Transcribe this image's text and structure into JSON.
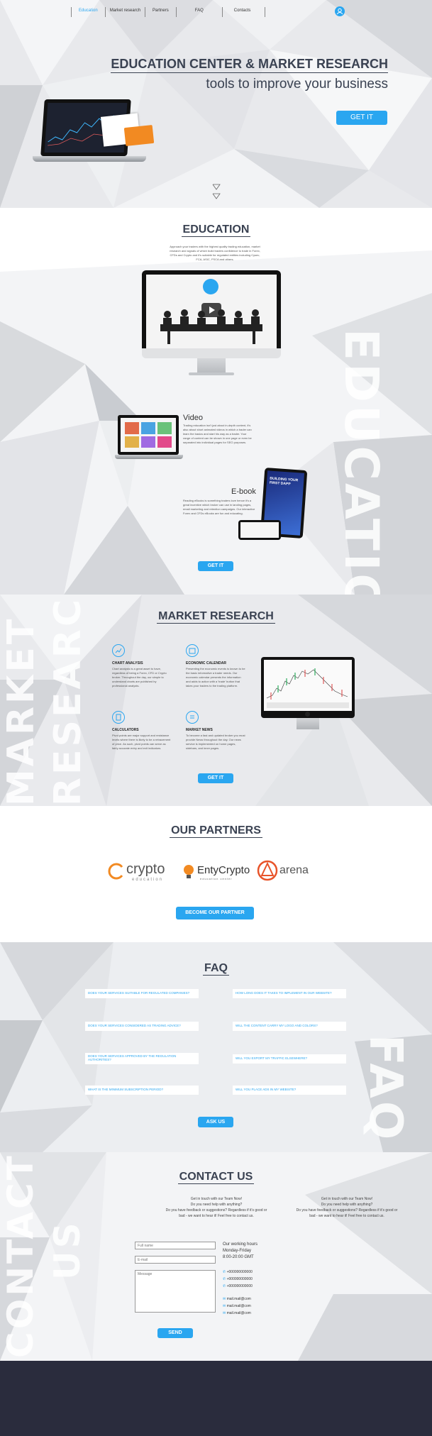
{
  "nav": {
    "items": [
      {
        "label": "Education",
        "active": true
      },
      {
        "label": "Market research",
        "active": false
      },
      {
        "label": "Partners",
        "active": false
      },
      {
        "label": "FAQ",
        "active": false
      },
      {
        "label": "Contacts",
        "active": false
      }
    ],
    "user_icon": "user-icon"
  },
  "hero": {
    "title": "EDUCATION CENTER & MARKET RESEARCH",
    "subtitle": "tools to improve your business",
    "cta": "GET IT",
    "scroll_icon": "chevron-down-icon"
  },
  "education": {
    "title": "EDUCATION",
    "intro": "Approach your traders with the highest quality trading education, market research and signals of which build traders confidence to trade in Forex, CFDs and Crypto and it's suitable for regulated entities including Cysec, FCA, ASIC, FSCA and others.",
    "screen_badge": "FORKHT",
    "video_title": "Video",
    "video_text": "Trading education isn't just about in-depth content, it's also about short animated videos in which a trader can learn the basics and start his way as a trader. Your range of content can be shown in one page or even be separated into individual pages for SEO purposes.",
    "ebook_title": "E-book",
    "ebook_text": "Reading eBooks is something traders love hence it's a great incentive which broker can use in landing pages, email marketing and retention campaigns. Our interactive Forex and CFDs eBooks are fun and educating.",
    "ebook_cover": "BUILDING YOUR FIRST DAPP",
    "cta": "GET IT",
    "bg_word": "EDUCATION"
  },
  "market": {
    "title": "MARKET RESEARCH",
    "bg_word_1": "MARKET",
    "bg_word_2": "RESEARCH",
    "items": [
      {
        "title": "CHART ANALYSIS",
        "text": "Chart analysis is a great asset to have, regardless of being a Forex, CFD or Crypto broker. Throughout the day, our simple to understand charts are published by professional analysts.",
        "icon": "chart-icon"
      },
      {
        "title": "ECONOMIC CALENDAR",
        "text": "Presenting the economic events is known to be the basic informative a trader needs. Our economic calendar presents the information and adds to action with a 'trade' button that takes your traders to the trading platform.",
        "icon": "calendar-icon"
      },
      {
        "title": "CALCULATORS",
        "text": "Pivot points are major support and resistance levels where there is likely to be a retracement of price. As such, pivot points can serve as fairly accurate entry and exit indicators.",
        "icon": "calculator-icon"
      },
      {
        "title": "MARKET NEWS",
        "text": "To become a fast and updated broker you must provide News throughout the day. Our news service is implemented on home pages, sidebars, and inner pages.",
        "icon": "news-icon"
      }
    ],
    "cta": "GET IT"
  },
  "partners": {
    "title": "OUR PARTNERS",
    "logos": [
      {
        "name": "crypto",
        "sub": "education"
      },
      {
        "name": "EntyCrypto",
        "sub": "education center"
      },
      {
        "name": "arena",
        "sub": ""
      }
    ],
    "cta": "BECOME OUR PARTNER"
  },
  "faq": {
    "title": "FAQ",
    "bg_word": "FAQ",
    "questions_left": [
      "DOES YOUR SERVICES SUITABLE FOR REGULATED COMPANIES?",
      "DOES YOUR SERVICES CONSIDERED AS TRADING ADVICE?",
      "DOES YOUR SERVICES APPROVED BY THE REGULATION AUTHORITIES?",
      "WHAT IS THE MINIMUM SUBSCRIPTION PERIOD?"
    ],
    "questions_right": [
      "HOW LONG DOES IT TAKES TO IMPLEMENT IN OUR WEBSITE?",
      "WILL THE CONTENT CARRY MY LOGO AND COLORS?",
      "WILL YOU EXPORT MY TRAFFIC ELSEWHERE?",
      "WILL YOU PLACE ADS IN MY WEBSITE?"
    ],
    "cta": "ASK US"
  },
  "contact": {
    "title": "CONTACT US",
    "bg_word_1": "CONTACT",
    "bg_word_2": "US",
    "blurb_lines": [
      "Get in touch with our Team Now!",
      "Do you need help with anything?",
      "Do you have feedback or suggestions? Regardless if it's good or",
      "bad - we want to hear it! Feel free to contact us."
    ],
    "fields": {
      "name": "Full name",
      "email": "E-mail",
      "message": "Message"
    },
    "hours_title": "Our working hours",
    "hours_days": "Monday-Friday",
    "hours_time": "8:00-20:00 GMT",
    "phones": [
      "+000000000000",
      "+000000000000",
      "+000000000000"
    ],
    "emails": [
      "mail.mail@com",
      "mail.mail@com",
      "mail.mail@com"
    ],
    "send": "SEND"
  },
  "colors": {
    "accent": "#2aa6f0",
    "dark": "#2a2c3d",
    "heading": "#3a4252",
    "orange": "#f28a22"
  }
}
